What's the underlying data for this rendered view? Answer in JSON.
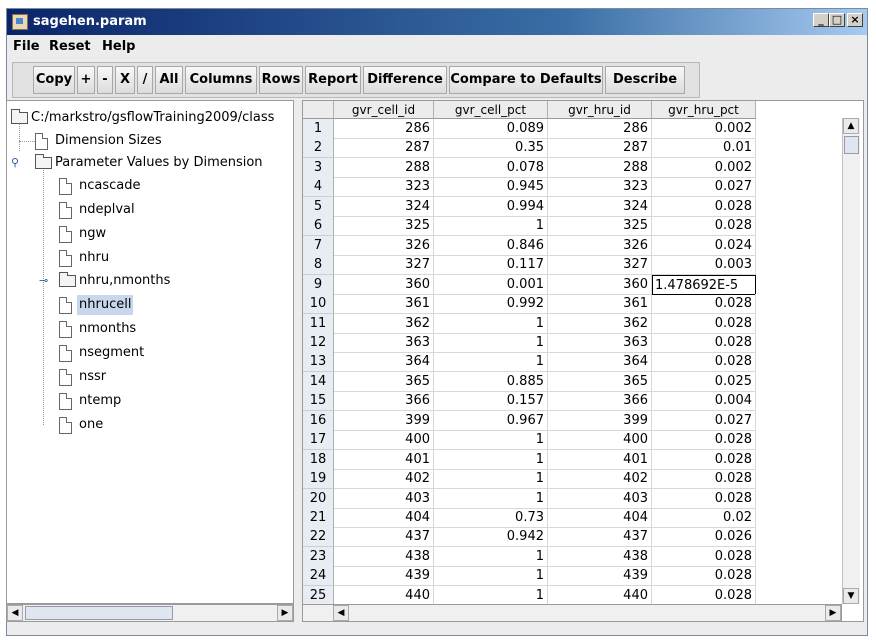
{
  "window": {
    "title": "sagehen.param"
  },
  "menu": [
    "File",
    "Reset",
    "Help"
  ],
  "toolbar": [
    "Copy",
    "+",
    "-",
    "X",
    "/",
    "All",
    "Columns",
    "Rows",
    "Report",
    "Difference",
    "Compare to Defaults",
    "Describe"
  ],
  "tree": {
    "root": "C:/markstro/gsflowTraining2009/class",
    "dimension_sizes": "Dimension Sizes",
    "param_by_dim": "Parameter Values by Dimension",
    "children": [
      "ncascade",
      "ndeplval",
      "ngw",
      "nhru",
      "nhru,nmonths",
      "nhrucell",
      "nmonths",
      "nsegment",
      "nssr",
      "ntemp",
      "one"
    ],
    "selected": "nhrucell"
  },
  "table": {
    "columns": [
      "gvr_cell_id",
      "gvr_cell_pct",
      "gvr_hru_id",
      "gvr_hru_pct"
    ],
    "rows": [
      [
        "1",
        "286",
        "0.089",
        "286",
        "0.002"
      ],
      [
        "2",
        "287",
        "0.35",
        "287",
        "0.01"
      ],
      [
        "3",
        "288",
        "0.078",
        "288",
        "0.002"
      ],
      [
        "4",
        "323",
        "0.945",
        "323",
        "0.027"
      ],
      [
        "5",
        "324",
        "0.994",
        "324",
        "0.028"
      ],
      [
        "6",
        "325",
        "1",
        "325",
        "0.028"
      ],
      [
        "7",
        "326",
        "0.846",
        "326",
        "0.024"
      ],
      [
        "8",
        "327",
        "0.117",
        "327",
        "0.003"
      ],
      [
        "9",
        "360",
        "0.001",
        "360",
        "1.478692E-5"
      ],
      [
        "10",
        "361",
        "0.992",
        "361",
        "0.028"
      ],
      [
        "11",
        "362",
        "1",
        "362",
        "0.028"
      ],
      [
        "12",
        "363",
        "1",
        "363",
        "0.028"
      ],
      [
        "13",
        "364",
        "1",
        "364",
        "0.028"
      ],
      [
        "14",
        "365",
        "0.885",
        "365",
        "0.025"
      ],
      [
        "15",
        "366",
        "0.157",
        "366",
        "0.004"
      ],
      [
        "16",
        "399",
        "0.967",
        "399",
        "0.027"
      ],
      [
        "17",
        "400",
        "1",
        "400",
        "0.028"
      ],
      [
        "18",
        "401",
        "1",
        "401",
        "0.028"
      ],
      [
        "19",
        "402",
        "1",
        "402",
        "0.028"
      ],
      [
        "20",
        "403",
        "1",
        "403",
        "0.028"
      ],
      [
        "21",
        "404",
        "0.73",
        "404",
        "0.02"
      ],
      [
        "22",
        "437",
        "0.942",
        "437",
        "0.026"
      ],
      [
        "23",
        "438",
        "1",
        "438",
        "0.028"
      ],
      [
        "24",
        "439",
        "1",
        "439",
        "0.028"
      ],
      [
        "25",
        "440",
        "1",
        "440",
        "0.028"
      ]
    ],
    "editing_row": 9
  }
}
